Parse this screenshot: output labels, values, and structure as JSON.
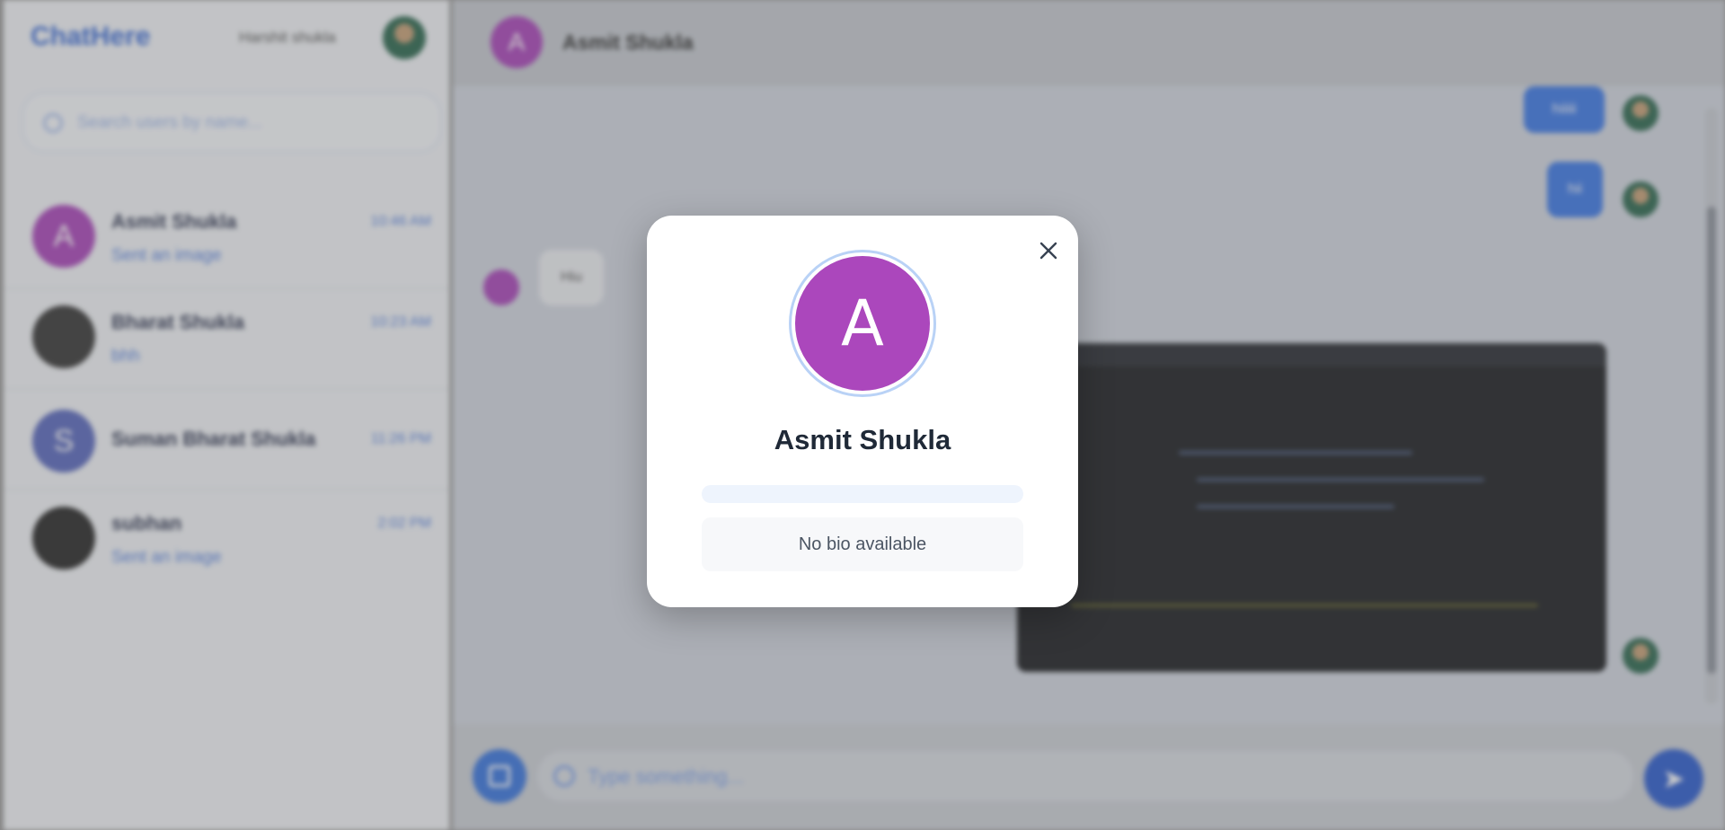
{
  "app": {
    "logo": "ChatHere",
    "current_user": "Harshit shukla"
  },
  "search": {
    "placeholder": "Search users by name..."
  },
  "chats": [
    {
      "name": "Asmit Shukla",
      "initial": "A",
      "time": "10:46 AM",
      "last": "Sent an image",
      "color": "#ab47bc"
    },
    {
      "name": "Bharat Shukla",
      "initial": "",
      "time": "10:23 AM",
      "last": "bhh",
      "color": "#3a3a3a"
    },
    {
      "name": "Suman Bharat Shukla",
      "initial": "S",
      "time": "11:26 PM",
      "last": "",
      "color": "#5c6bc0"
    },
    {
      "name": "subhan",
      "initial": "",
      "time": "2:02 PM",
      "last": "Sent an image",
      "color": "#2b2b2b"
    }
  ],
  "conversation": {
    "header_name": "Asmit Shukla",
    "header_initial": "A",
    "incoming_text": "Hiu",
    "outgoing_1": "hiiiii",
    "outgoing_2": "hii"
  },
  "composer": {
    "placeholder": "Type something..."
  },
  "modal": {
    "initial": "A",
    "name": "Asmit Shukla",
    "bio": "No bio available"
  },
  "colors": {
    "accent": "#3f7be8",
    "avatar_purple": "#ab47bc",
    "text_dark": "#1f2937"
  }
}
